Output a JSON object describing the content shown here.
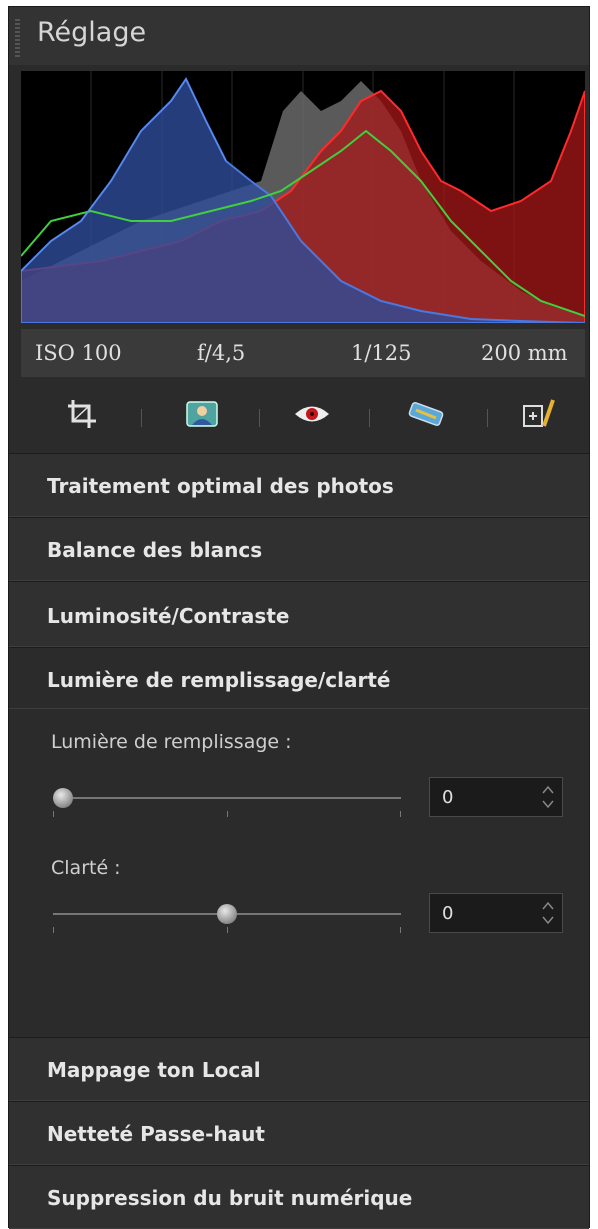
{
  "panel": {
    "title": "Réglage"
  },
  "exif": {
    "iso": "ISO 100",
    "aperture": "f/4,5",
    "shutter": "1/125",
    "focal": "200 mm"
  },
  "toolbar": {
    "tools": [
      "crop-icon",
      "portrait-icon",
      "red-eye-icon",
      "straighten-icon",
      "paint-icon"
    ]
  },
  "sections": {
    "optimal": "Traitement optimal des photos",
    "white_balance": "Balance des blancs",
    "brightness": "Luminosité/Contraste",
    "fill_light": "Lumière de remplissage/clarté",
    "tone_mapping": "Mappage ton Local",
    "sharpness": "Netteté Passe-haut",
    "noise": "Suppression du bruit numérique"
  },
  "fill_light_panel": {
    "fill_label": "Lumière de remplissage :",
    "fill_value": "0",
    "fill_level": 0,
    "clarity_label": "Clarté :",
    "clarity_value": "0",
    "clarity_level": 0.5
  },
  "colors": {
    "panel_bg": "#2b2b2b",
    "histogram_bg": "#000000",
    "red": "#d12020",
    "green": "#3fbf3f",
    "blue": "#3a5fd0"
  }
}
